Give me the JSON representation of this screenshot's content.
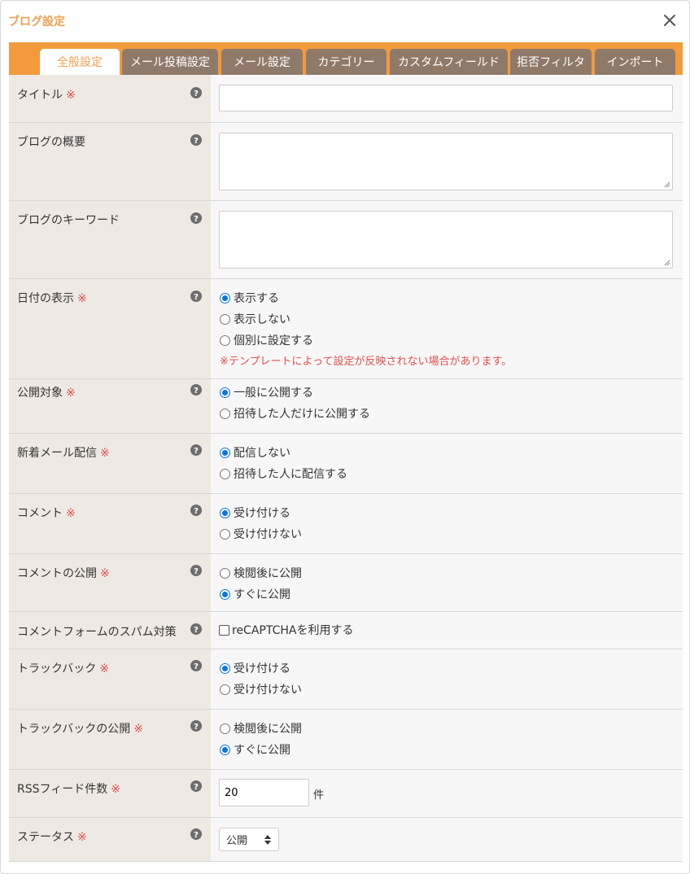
{
  "dialog": {
    "title": "ブログ設定",
    "required_mark": "※"
  },
  "tabs": [
    {
      "label": "全般設定",
      "active": true
    },
    {
      "label": "メール投稿設定",
      "active": false
    },
    {
      "label": "メール設定",
      "active": false
    },
    {
      "label": "カテゴリー",
      "active": false
    },
    {
      "label": "カスタムフィールド",
      "active": false
    },
    {
      "label": "拒否フィルタ",
      "active": false
    },
    {
      "label": "インポート",
      "active": false
    }
  ],
  "fields": {
    "title": {
      "label": "タイトル",
      "required": true,
      "value": ""
    },
    "summary": {
      "label": "ブログの概要",
      "required": false,
      "value": ""
    },
    "keywords": {
      "label": "ブログのキーワード",
      "required": false,
      "value": ""
    },
    "date_display": {
      "label": "日付の表示",
      "required": true,
      "options": [
        {
          "label": "表示する",
          "checked": true
        },
        {
          "label": "表示しない",
          "checked": false
        },
        {
          "label": "個別に設定する",
          "checked": false
        }
      ],
      "note": "※テンプレートによって設定が反映されない場合があります。"
    },
    "visibility": {
      "label": "公開対象",
      "required": true,
      "options": [
        {
          "label": "一般に公開する",
          "checked": true
        },
        {
          "label": "招待した人だけに公開する",
          "checked": false
        }
      ]
    },
    "new_mail": {
      "label": "新着メール配信",
      "required": true,
      "options": [
        {
          "label": "配信しない",
          "checked": true
        },
        {
          "label": "招待した人に配信する",
          "checked": false
        }
      ]
    },
    "comment": {
      "label": "コメント",
      "required": true,
      "options": [
        {
          "label": "受け付ける",
          "checked": true
        },
        {
          "label": "受け付けない",
          "checked": false
        }
      ]
    },
    "comment_publish": {
      "label": "コメントの公開",
      "required": true,
      "options": [
        {
          "label": "検閲後に公開",
          "checked": false
        },
        {
          "label": "すぐに公開",
          "checked": true
        }
      ]
    },
    "spam": {
      "label": "コメントフォームのスパム対策",
      "required": false,
      "checkbox_label": "reCAPTCHAを利用する",
      "checked": false
    },
    "trackback": {
      "label": "トラックバック",
      "required": true,
      "options": [
        {
          "label": "受け付ける",
          "checked": true
        },
        {
          "label": "受け付けない",
          "checked": false
        }
      ]
    },
    "trackback_publish": {
      "label": "トラックバックの公開",
      "required": true,
      "options": [
        {
          "label": "検閲後に公開",
          "checked": false
        },
        {
          "label": "すぐに公開",
          "checked": true
        }
      ]
    },
    "rss_count": {
      "label": "RSSフィード件数",
      "required": true,
      "value": "20",
      "unit": "件"
    },
    "status": {
      "label": "ステータス",
      "required": true,
      "value": "公開"
    }
  },
  "colors": {
    "accent": "#f39a3c",
    "tab_inactive": "#8f7a69",
    "title": "#f0a050",
    "required": "#e05050",
    "label_bg": "#efe9e3",
    "field_bg": "#f7f7f7",
    "radio_checked": "#0b74e5"
  },
  "icons": {
    "close": "close-icon",
    "help": "help-icon",
    "select": "select-arrows-icon"
  }
}
